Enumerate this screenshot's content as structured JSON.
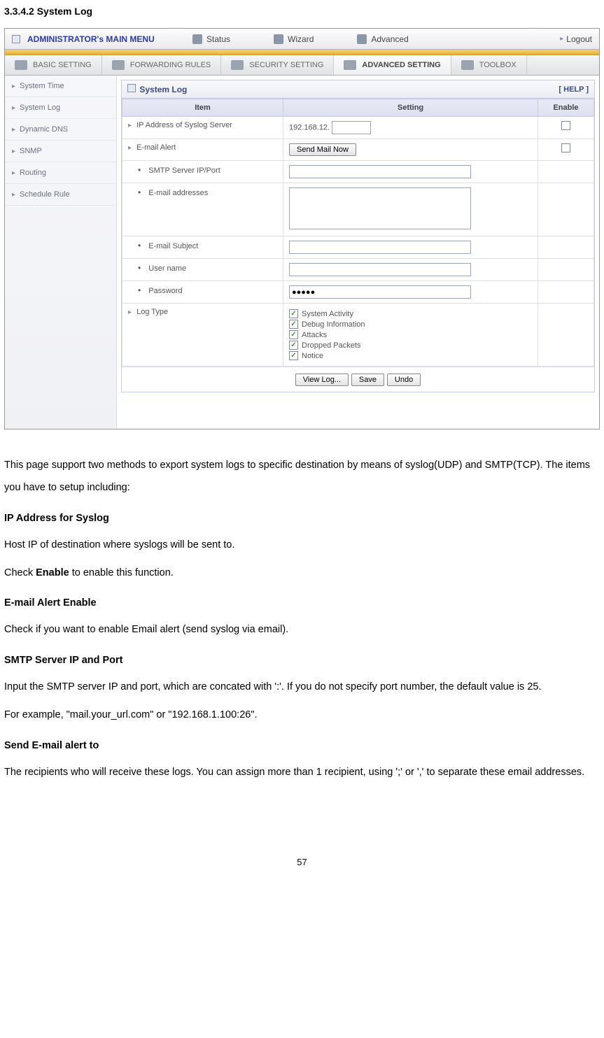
{
  "doc": {
    "section_number": "3.3.4.2 System Log",
    "page_number": "57",
    "intro_paragraph": "This page support two methods to export system logs to specific destination by means of syslog(UDP) and SMTP(TCP). The items you have to setup including:",
    "h_ip_syslog": "IP Address for Syslog",
    "p_ip_syslog1": "Host IP of destination where syslogs will be sent to.",
    "p_ip_syslog2_a": "Check ",
    "p_ip_syslog2_b": "Enable",
    "p_ip_syslog2_c": " to enable this function.",
    "h_email_alert": "E-mail Alert Enable",
    "p_email_alert": "Check if you want to enable Email alert (send syslog via email).",
    "h_smtp": "SMTP Server IP and Port",
    "p_smtp": "Input the SMTP server IP and port, which are concated with ':'. If you do not specify port number, the default value is 25.",
    "p_smtp_example": "For example, \"mail.your_url.com\" or \"192.168.1.100:26\".",
    "h_send_email": "Send E-mail alert to",
    "p_send_email": "The recipients who will receive these logs. You can assign more than 1 recipient, using ';' or ',' to separate these email addresses."
  },
  "ui": {
    "topbar": {
      "main_menu": "ADMINISTRATOR's MAIN MENU",
      "status": "Status",
      "wizard": "Wizard",
      "advanced": "Advanced",
      "logout": "Logout"
    },
    "tabs": {
      "basic": "BASIC SETTING",
      "forwarding": "FORWARDING RULES",
      "security": "SECURITY SETTING",
      "advanced": "ADVANCED SETTING",
      "toolbox": "TOOLBOX"
    },
    "sidebar": {
      "items": [
        "System Time",
        "System Log",
        "Dynamic DNS",
        "SNMP",
        "Routing",
        "Schedule Rule"
      ]
    },
    "panel": {
      "title": "System Log",
      "help": "[ HELP ]",
      "col_item": "Item",
      "col_setting": "Setting",
      "col_enable": "Enable",
      "rows": {
        "ip_syslog_label": "IP Address of Syslog Server",
        "ip_syslog_value_prefix": "192.168.12.",
        "ip_syslog_suffix_value": "",
        "email_alert_label": "E-mail Alert",
        "send_mail_now_btn": "Send Mail Now",
        "smtp_label": "SMTP Server IP/Port",
        "smtp_value": "",
        "email_addresses_label": "E-mail addresses",
        "email_addresses_value": "",
        "email_subject_label": "E-mail Subject",
        "email_subject_value": "",
        "username_label": "User name",
        "username_value": "",
        "password_label": "Password",
        "password_value": "●●●●●",
        "log_type_label": "Log Type",
        "log_type_options": [
          "System Activity",
          "Debug Information",
          "Attacks",
          "Dropped Packets",
          "Notice"
        ]
      },
      "buttons": {
        "view_log": "View Log...",
        "save": "Save",
        "undo": "Undo"
      }
    }
  }
}
